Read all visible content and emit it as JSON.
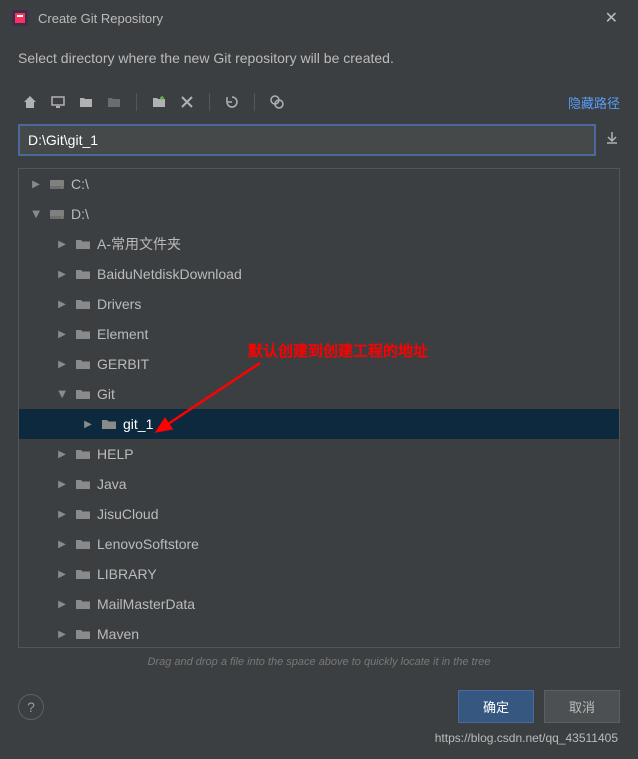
{
  "titlebar": {
    "title": "Create Git Repository"
  },
  "subtitle": "Select directory where the new Git repository will be created.",
  "toolbar": {
    "hide_path": "隐藏路径"
  },
  "path": {
    "value": "D:\\Git\\git_1"
  },
  "tree": {
    "items": [
      {
        "label": "C:\\",
        "indent": 0,
        "expanded": false,
        "type": "drive"
      },
      {
        "label": "D:\\",
        "indent": 0,
        "expanded": true,
        "type": "drive"
      },
      {
        "label": "A-常用文件夹",
        "indent": 1,
        "expanded": false,
        "type": "folder"
      },
      {
        "label": "BaiduNetdiskDownload",
        "indent": 1,
        "expanded": false,
        "type": "folder"
      },
      {
        "label": "Drivers",
        "indent": 1,
        "expanded": false,
        "type": "folder"
      },
      {
        "label": "Element",
        "indent": 1,
        "expanded": false,
        "type": "folder"
      },
      {
        "label": "GERBIT",
        "indent": 1,
        "expanded": false,
        "type": "folder"
      },
      {
        "label": "Git",
        "indent": 1,
        "expanded": true,
        "type": "folder"
      },
      {
        "label": "git_1",
        "indent": 2,
        "expanded": false,
        "type": "folder",
        "selected": true
      },
      {
        "label": "HELP",
        "indent": 1,
        "expanded": false,
        "type": "folder"
      },
      {
        "label": "Java",
        "indent": 1,
        "expanded": false,
        "type": "folder"
      },
      {
        "label": "JisuCloud",
        "indent": 1,
        "expanded": false,
        "type": "folder"
      },
      {
        "label": "LenovoSoftstore",
        "indent": 1,
        "expanded": false,
        "type": "folder"
      },
      {
        "label": "LIBRARY",
        "indent": 1,
        "expanded": false,
        "type": "folder"
      },
      {
        "label": "MailMasterData",
        "indent": 1,
        "expanded": false,
        "type": "folder"
      },
      {
        "label": "Maven",
        "indent": 1,
        "expanded": false,
        "type": "folder"
      }
    ]
  },
  "drag_hint": "Drag and drop a file into the space above to quickly locate it in the tree",
  "footer": {
    "ok": "确定",
    "cancel": "取消"
  },
  "annotation": {
    "text": "默认创建到创建工程的地址"
  },
  "watermark": "https://blog.csdn.net/qq_43511405"
}
